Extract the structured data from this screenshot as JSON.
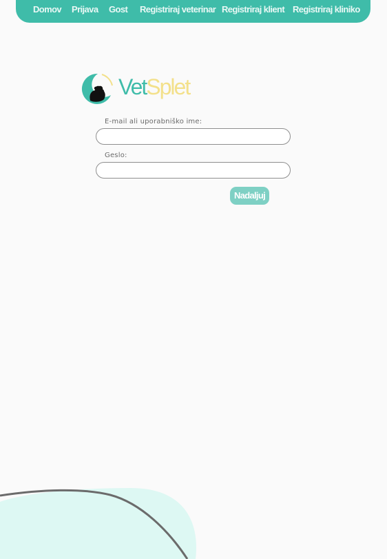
{
  "nav": {
    "items": [
      {
        "label": "Domov"
      },
      {
        "label": "Prijava"
      },
      {
        "label": "Gost"
      },
      {
        "label": "Registriraj veterinar"
      },
      {
        "label": "Registriraj klient"
      },
      {
        "label": "Registriraj kliniko"
      }
    ]
  },
  "logo": {
    "part1": "Vet",
    "part2": "Splet",
    "icon": "pets-crescent-icon"
  },
  "form": {
    "username_label": "E-mail ali uporabniško ime:",
    "username_value": "",
    "password_label": "Geslo:",
    "password_value": "",
    "submit_label": "Nadaljuj"
  },
  "colors": {
    "primary": "#3fbca9",
    "logo_yellow": "#f3e08a",
    "button": "#7ed0c4",
    "deco_blob": "#ddf8f3"
  }
}
